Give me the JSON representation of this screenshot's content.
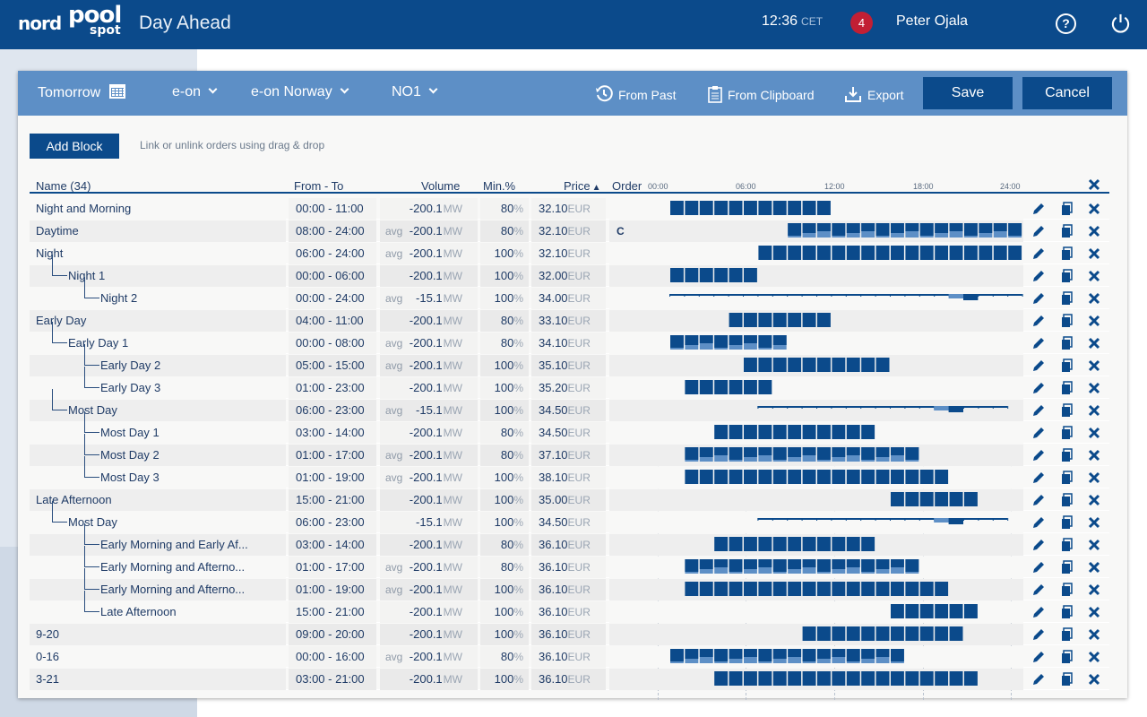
{
  "header": {
    "logo": {
      "part1": "nord",
      "part2": "pool",
      "part3": "spot"
    },
    "app_title": "Day Ahead",
    "time": "12:36",
    "timezone": "CET",
    "notifications": "4",
    "user": "Peter Ojala",
    "help_label": "?"
  },
  "toolbar": {
    "date": "Tomorrow",
    "company": "e-on",
    "portfolio": "e-on Norway",
    "area": "NO1",
    "from_past": "From Past",
    "from_clipboard": "From Clipboard",
    "export": "Export",
    "save": "Save",
    "cancel": "Cancel"
  },
  "actions": {
    "add_block": "Add Block",
    "hint": "Link or unlink orders using drag & drop"
  },
  "table": {
    "headers": {
      "name": "Name (34)",
      "from_to": "From  - To",
      "volume": "Volume",
      "min": "Min.%",
      "price": "Price",
      "order": "Order"
    },
    "ticks": [
      "00:00",
      "06:00",
      "12:00",
      "18:00",
      "24:00"
    ],
    "rows": [
      {
        "name": "Night and Morning",
        "level": 0,
        "time": "00:00 - 11:00",
        "avg": false,
        "volume": "-200.1",
        "vol_unit": "MW",
        "min": "80",
        "price": "32.10",
        "currency": "EUR",
        "order": "",
        "start": 0,
        "end": 11,
        "style": "block"
      },
      {
        "name": "Daytime",
        "level": 0,
        "time": "08:00 - 24:00",
        "avg": true,
        "volume": "-200.1",
        "vol_unit": "MW",
        "min": "80",
        "price": "32.10",
        "currency": "EUR",
        "order": "C",
        "start": 8,
        "end": 24,
        "style": "profile"
      },
      {
        "name": "Night",
        "level": 0,
        "time": "06:00 - 24:00",
        "avg": true,
        "volume": "-200.1",
        "vol_unit": "MW",
        "min": "100",
        "price": "32.10",
        "currency": "EUR",
        "order": "",
        "start": 6,
        "end": 24,
        "style": "block"
      },
      {
        "name": "Night 1",
        "level": 1,
        "time": "00:00 - 06:00",
        "avg": false,
        "volume": "-200.1",
        "vol_unit": "MW",
        "min": "100",
        "price": "32.00",
        "currency": "EUR",
        "order": "",
        "start": 0,
        "end": 6,
        "style": "block"
      },
      {
        "name": "Night 2",
        "level": 2,
        "time": "00:00 - 24:00",
        "avg": true,
        "volume": "-15.1",
        "vol_unit": "MW",
        "min": "100",
        "price": "34.00",
        "currency": "EUR",
        "order": "",
        "start": 0,
        "end": 24,
        "style": "thin"
      },
      {
        "name": "Early Day",
        "level": 0,
        "time": "04:00 - 11:00",
        "avg": false,
        "volume": "-200.1",
        "vol_unit": "MW",
        "min": "80",
        "price": "33.10",
        "currency": "EUR",
        "order": "",
        "start": 4,
        "end": 11,
        "style": "block"
      },
      {
        "name": "Early Day 1",
        "level": 1,
        "time": "00:00 - 08:00",
        "avg": true,
        "volume": "-200.1",
        "vol_unit": "MW",
        "min": "80",
        "price": "34.10",
        "currency": "EUR",
        "order": "",
        "start": 0,
        "end": 8,
        "style": "profile"
      },
      {
        "name": "Early Day 2",
        "level": 2,
        "time": "05:00 - 15:00",
        "avg": true,
        "volume": "-200.1",
        "vol_unit": "MW",
        "min": "100",
        "price": "35.10",
        "currency": "EUR",
        "order": "",
        "start": 5,
        "end": 15,
        "style": "block"
      },
      {
        "name": "Early Day 3",
        "level": 2,
        "time": "01:00 - 23:00",
        "avg": false,
        "volume": "-200.1",
        "vol_unit": "MW",
        "min": "100",
        "price": "35.20",
        "currency": "EUR",
        "order": "",
        "start": 1,
        "end": 7,
        "style": "block"
      },
      {
        "name": "Most Day",
        "level": 1,
        "time": "06:00 - 23:00",
        "avg": true,
        "volume": "-15.1",
        "vol_unit": "MW",
        "min": "100",
        "price": "34.50",
        "currency": "EUR",
        "order": "",
        "start": 6,
        "end": 23,
        "style": "thin"
      },
      {
        "name": "Most Day 1",
        "level": 2,
        "time": "03:00 - 14:00",
        "avg": false,
        "volume": "-200.1",
        "vol_unit": "MW",
        "min": "80",
        "price": "34.50",
        "currency": "EUR",
        "order": "",
        "start": 3,
        "end": 14,
        "style": "block"
      },
      {
        "name": "Most Day 2",
        "level": 2,
        "time": "01:00 - 17:00",
        "avg": true,
        "volume": "-200.1",
        "vol_unit": "MW",
        "min": "80",
        "price": "37.10",
        "currency": "EUR",
        "order": "",
        "start": 1,
        "end": 17,
        "style": "profile"
      },
      {
        "name": "Most Day 3",
        "level": 2,
        "time": "01:00 - 19:00",
        "avg": true,
        "volume": "-200.1",
        "vol_unit": "MW",
        "min": "100",
        "price": "38.10",
        "currency": "EUR",
        "order": "",
        "start": 1,
        "end": 19,
        "style": "block"
      },
      {
        "name": "Late Afternoon",
        "level": 0,
        "time": "15:00 - 21:00",
        "avg": false,
        "volume": "-200.1",
        "vol_unit": "MW",
        "min": "100",
        "price": "35.00",
        "currency": "EUR",
        "order": "",
        "start": 15,
        "end": 21,
        "style": "block"
      },
      {
        "name": "Most Day",
        "level": 1,
        "time": "06:00 - 23:00",
        "avg": false,
        "volume": "-15.1",
        "vol_unit": "MW",
        "min": "100",
        "price": "34.50",
        "currency": "EUR",
        "order": "",
        "start": 6,
        "end": 23,
        "style": "thin"
      },
      {
        "name": "Early Morning and Early Af...",
        "level": 2,
        "time": "03:00 - 14:00",
        "avg": false,
        "volume": "-200.1",
        "vol_unit": "MW",
        "min": "80",
        "price": "36.10",
        "currency": "EUR",
        "order": "",
        "start": 3,
        "end": 14,
        "style": "block"
      },
      {
        "name": "Early Morning and Afterno...",
        "level": 2,
        "time": "01:00 - 17:00",
        "avg": true,
        "volume": "-200.1",
        "vol_unit": "MW",
        "min": "80",
        "price": "36.10",
        "currency": "EUR",
        "order": "",
        "start": 1,
        "end": 17,
        "style": "profile"
      },
      {
        "name": "Early Morning and Afterno...",
        "level": 2,
        "time": "01:00 - 19:00",
        "avg": true,
        "volume": "-200.1",
        "vol_unit": "MW",
        "min": "100",
        "price": "36.10",
        "currency": "EUR",
        "order": "",
        "start": 1,
        "end": 19,
        "style": "block"
      },
      {
        "name": "Late Afternoon",
        "level": 2,
        "time": "15:00 - 21:00",
        "avg": false,
        "volume": "-200.1",
        "vol_unit": "MW",
        "min": "100",
        "price": "36.10",
        "currency": "EUR",
        "order": "",
        "start": 15,
        "end": 21,
        "style": "block"
      },
      {
        "name": "9-20",
        "level": 0,
        "time": "09:00 - 20:00",
        "avg": false,
        "volume": "-200.1",
        "vol_unit": "MW",
        "min": "100",
        "price": "36.10",
        "currency": "EUR",
        "order": "",
        "start": 9,
        "end": 20,
        "style": "block"
      },
      {
        "name": "0-16",
        "level": 0,
        "time": "00:00 - 16:00",
        "avg": true,
        "volume": "-200.1",
        "vol_unit": "MW",
        "min": "80",
        "price": "36.10",
        "currency": "EUR",
        "order": "",
        "start": 0,
        "end": 16,
        "style": "profile"
      },
      {
        "name": "3-21",
        "level": 0,
        "time": "03:00 - 21:00",
        "avg": false,
        "volume": "-200.1",
        "vol_unit": "MW",
        "min": "100",
        "price": "36.10",
        "currency": "EUR",
        "order": "",
        "start": 3,
        "end": 21,
        "style": "block"
      }
    ],
    "avg_label": "avg",
    "min_unit": "%"
  },
  "colors": {
    "header_bg": "#0b4a8b",
    "toolbar_bg": "#5d8fc6",
    "bar": "#0b4a8b",
    "bar_light": "#5d8fc6",
    "badge": "#c21f34"
  }
}
